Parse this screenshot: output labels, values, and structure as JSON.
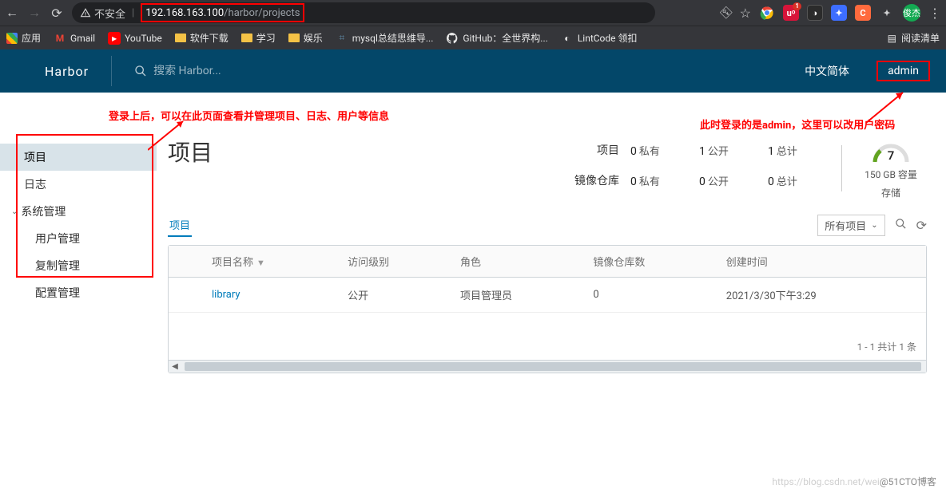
{
  "browser": {
    "insecure_label": "不安全",
    "url_host": "192.168.163.100",
    "url_path": "/harbor/projects",
    "avatar_text": "俊杰",
    "reading_list": "阅读清单"
  },
  "bookmarks": {
    "apps": "应用",
    "items": [
      {
        "label": "Gmail"
      },
      {
        "label": "YouTube"
      },
      {
        "label": "软件下载"
      },
      {
        "label": "学习"
      },
      {
        "label": "娱乐"
      },
      {
        "label": "mysql总结思维导..."
      },
      {
        "label": "GitHub：全世界构..."
      },
      {
        "label": "LintCode 领扣"
      }
    ]
  },
  "header": {
    "logo": "Harbor",
    "search_placeholder": "搜索 Harbor...",
    "language": "中文简体",
    "user": "admin"
  },
  "annotations": {
    "left": "登录上后，可以在此页面查看并管理项目、日志、用户等信息",
    "right": "此时登录的是admin，这里可以改用户密码"
  },
  "sidebar": {
    "items": {
      "projects": "项目",
      "logs": "日志",
      "sysadmin": "系统管理",
      "users": "用户管理",
      "replication": "复制管理",
      "config": "配置管理"
    }
  },
  "content": {
    "title": "项目",
    "summary": {
      "project_label": "项目",
      "repo_label": "镜像仓库",
      "priv_prefix": "私有",
      "pub_prefix": "公开",
      "total_prefix": "总计",
      "proj_private": "0",
      "proj_public": "1",
      "proj_total": "1",
      "repo_private": "0",
      "repo_public": "0",
      "repo_total": "0",
      "gauge_value": "7",
      "gauge_label": "150 GB 容量",
      "gauge_label2": "存储"
    },
    "tab": "项目",
    "filter_dropdown": "所有项目",
    "table": {
      "headers": {
        "name": "项目名称",
        "access": "访问级别",
        "role": "角色",
        "repo_count": "镜像仓库数",
        "created": "创建时间"
      },
      "rows": [
        {
          "name": "library",
          "access": "公开",
          "role": "项目管理员",
          "repo_count": "0",
          "created": "2021/3/30下午3:29"
        }
      ],
      "footer": "1 - 1 共计 1 条"
    }
  },
  "watermark": {
    "light": "https://blog.csdn.net/wei",
    "dark": "@51CTO博客"
  }
}
